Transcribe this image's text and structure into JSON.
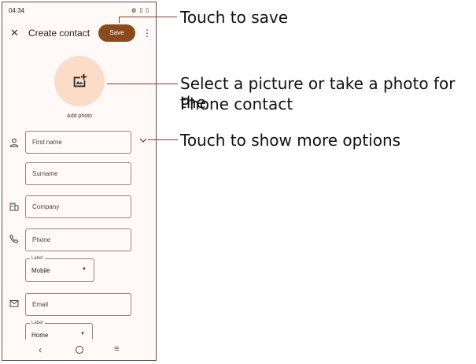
{
  "status_bar": {
    "time": "04:34",
    "left_icons": "▪ ✦ ◎",
    "right_icons": "◍ ▯ ▯"
  },
  "app_bar": {
    "close_glyph": "✕",
    "title": "Create contact",
    "save_label": "Save",
    "more_glyph": "⋮"
  },
  "photo": {
    "label": "Add photo"
  },
  "fields": {
    "first_name": "First name",
    "surname": "Surname",
    "company": "Company",
    "phone": "Phone",
    "phone_label_legend": "Label",
    "phone_label_value": "Mobile",
    "email": "Email",
    "email_label_legend": "Label",
    "email_label_value": "Home"
  },
  "nav_bar": {
    "back": "‹",
    "menu": "≡"
  },
  "callouts": {
    "save": "Touch to save",
    "photo_line1": "Select a picture or take a photo for the",
    "photo_line2": "Phone contact",
    "more": "Touch to show more options"
  },
  "colors": {
    "accent": "#8b4a1e",
    "photo_bg": "#fadcc8",
    "callout_line": "#8b3a2a"
  }
}
